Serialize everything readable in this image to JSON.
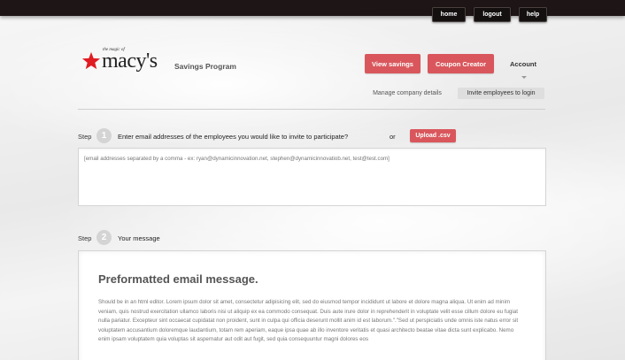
{
  "topnav": {
    "home": "home",
    "logout": "logout",
    "help": "help"
  },
  "brand": {
    "tagline": "the magic of",
    "wordmark": "macy's",
    "program": "Savings Program",
    "star_color": "#e11b22"
  },
  "header": {
    "view_savings": "View savings",
    "coupon_creator": "Coupon Creator",
    "account": "Account",
    "accent": "#d9575c"
  },
  "subnav": {
    "manage": "Manage company details",
    "invite": "Invite employees to login"
  },
  "step1": {
    "label": "Step",
    "number": "1",
    "text": "Enter email addresses of the employees you would like to invite to participate?",
    "or": "or",
    "upload": "Upload .csv",
    "placeholder": "[email addresses separated by a comma - ex: ryan@dynamicinnovation.net, stephen@dynamicinnovatiob.net, test@test.com]"
  },
  "step2": {
    "label": "Step",
    "number": "2",
    "text": "Your message",
    "message_title": "Preformatted email message.",
    "message_body": "Should be in an html editor. Lorem ipsum dolor sit amet, consectetur adipisicing elit, sed do eiusmod tempor incididunt ut labore et dolore magna aliqua. Ut enim ad minim veniam, quis nostrud exercitation ullamco laboris nisi ut aliquip ex ea commodo consequat. Duis aute irure dolor in reprehenderit in voluptate velit esse cillum dolore eu fugiat nulla pariatur. Excepteur sint occaecat cupidatat non proident, sunt in culpa qui officia deserunt mollit anim id est laborum.\".\"Sed ut perspiciatis unde omnis iste natus error sit voluptatem accusantium doloremque laudantium, totam rem aperiam, eaque ipsa quae ab illo inventore veritatis et quasi architecto beatae vitae dicta sunt explicabo. Nemo enim ipsam voluptatem quia voluptas sit aspernatur aut odit aut fugit, sed quia consequuntur magni dolores eos"
  }
}
